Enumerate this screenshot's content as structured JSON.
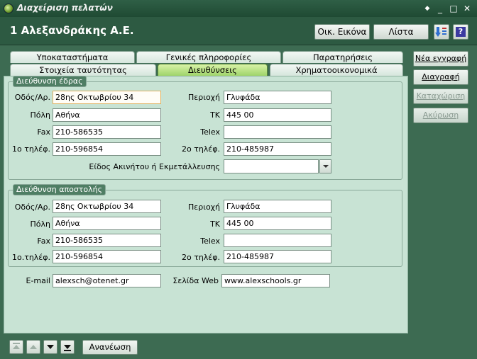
{
  "window": {
    "title": "Διαχείριση πελατών",
    "controls": [
      "◆",
      "_",
      "□",
      "✕"
    ]
  },
  "header": {
    "record_title": "1 Αλεξανδράκης Α.Ε.",
    "photo_button": "Οικ. Εικόνα",
    "list_button": "Λίστα",
    "sort_icon": "sort-icon",
    "help_icon": "help-icon",
    "help_label": "?"
  },
  "tabs_row1": [
    "Υποκαταστήματα",
    "Γενικές πληροφορίες",
    "Παρατηρήσεις"
  ],
  "tabs_row2": [
    "Στοιχεία ταυτότητας",
    "Διευθύνσεις",
    "Χρηματοοικονομικά"
  ],
  "active_tab": "Διευθύνσεις",
  "hq": {
    "legend": "Διεύθυνση έδρας",
    "street_label": "Οδός/Αρ.",
    "street": "28ης Οκτωβρίου 34",
    "area_label": "Περιοχή",
    "area": "Γλυφάδα",
    "city_label": "Πόλη",
    "city": "Αθήνα",
    "zip_label": "ΤΚ",
    "zip": "445 00",
    "fax_label": "Fax",
    "fax": "210-586535",
    "telex_label": "Telex",
    "telex": "",
    "phone1_label": "1ο τηλέφ.",
    "phone1": "210-596854",
    "phone2_label": "2ο τηλέφ.",
    "phone2": "210-485987",
    "property_label": "Είδος Ακινήτου ή Εκμετάλλευσης",
    "property": ""
  },
  "ship": {
    "legend": "Διεύθυνση αποστολής",
    "street_label": "Οδός/Αρ.",
    "street": "28ης Οκτωβρίου 34",
    "area_label": "Περιοχή",
    "area": "Γλυφάδα",
    "city_label": "Πόλη",
    "city": "Αθήνα",
    "zip_label": "ΤΚ",
    "zip": "445 00",
    "fax_label": "Fax",
    "fax": "210-586535",
    "telex_label": "Telex",
    "telex": "",
    "phone1_label": "1ο.τηλέφ.",
    "phone1": "210-596854",
    "phone2_label": "2ο τηλέφ.",
    "phone2": "210-485987"
  },
  "contact": {
    "email_label": "E-mail",
    "email": "alexsch@otenet.gr",
    "web_label": "Σελίδα Web",
    "web": "www.alexschools.gr"
  },
  "side_buttons": {
    "new": "Νέα εγγραφή",
    "delete": "Διαγραφή",
    "save": "Καταχώριση",
    "cancel": "Ακύρωση"
  },
  "footer": {
    "refresh": "Ανανέωση"
  },
  "colors": {
    "background": "#3d6b52",
    "panel": "#c8e3d4",
    "active_tab": "#9fd46a"
  }
}
